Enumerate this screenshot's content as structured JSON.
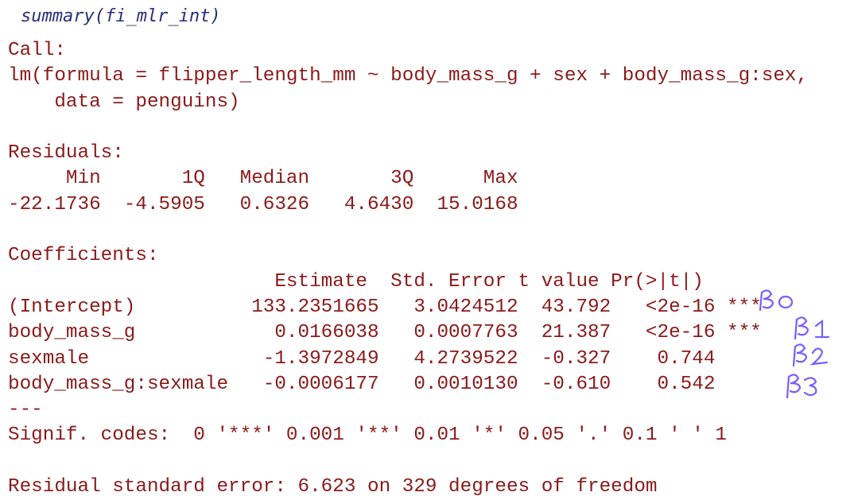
{
  "code": {
    "command": "summary(fi_mlr_int)"
  },
  "output": {
    "call_header": "Call:",
    "call_line1": "lm(formula = flipper_length_mm ~ body_mass_g + sex + body_mass_g:sex,",
    "call_line2": "    data = penguins)",
    "residuals_header": "Residuals:",
    "residuals_col_header": "     Min       1Q   Median       3Q      Max",
    "residuals_values": "-22.1736  -4.5905   0.6326   4.6430  15.0168",
    "coef_header": "Coefficients:",
    "coef_col_header": "                       Estimate  Std. Error t value Pr(>|t|)",
    "coef_rows": [
      "(Intercept)          133.2351665   3.0424512  43.792   <2e-16 ***",
      "body_mass_g            0.0166038   0.0007763  21.387   <2e-16 ***",
      "sexmale               -1.3972849   4.2739522  -0.327    0.744",
      "body_mass_g:sexmale   -0.0006177   0.0010130  -0.610    0.542"
    ],
    "separator": "---",
    "signif_codes": "Signif. codes:  0 '***' 0.001 '**' 0.01 '*' 0.05 '.' 0.1 ' ' 1",
    "residual_se": "Residual standard error: 6.623 on 329 degrees of freedom"
  },
  "annotations": {
    "ink_color": "#7a5cff"
  }
}
